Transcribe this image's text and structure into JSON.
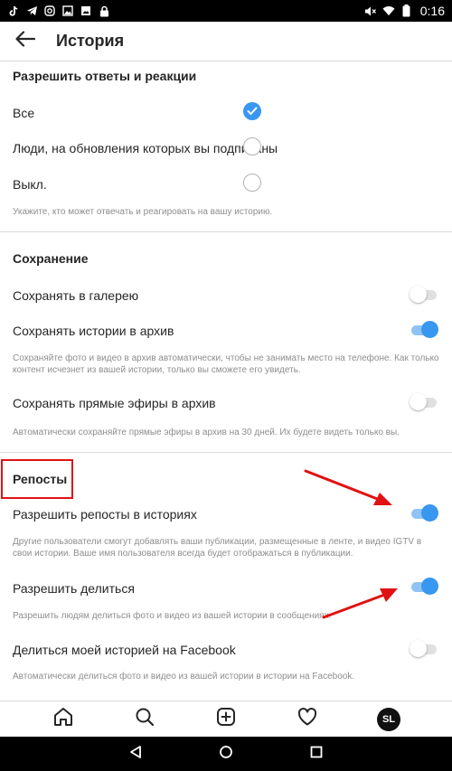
{
  "status_bar": {
    "time": "0:16",
    "icons": [
      "tiktok-icon",
      "telegram-icon",
      "instagram-icon",
      "gallery-icon",
      "image-icon",
      "lock-icon",
      "mute-icon",
      "wifi-icon",
      "battery-icon"
    ]
  },
  "header": {
    "back_icon": "arrow-left-icon",
    "title": "История"
  },
  "replies": {
    "title": "Разрешить ответы и реакции",
    "options": [
      {
        "label": "Все",
        "selected": true
      },
      {
        "label": "Люди, на обновления которых вы подписаны",
        "selected": false
      },
      {
        "label": "Выкл.",
        "selected": false
      }
    ],
    "helper": "Укажите, кто может отвечать и реагировать на вашу историю."
  },
  "saving": {
    "title": "Сохранение",
    "gallery_label": "Сохранять в галерею",
    "gallery_on": false,
    "archive_label": "Сохранять истории в архив",
    "archive_on": true,
    "archive_helper": "Сохраняйте фото и видео в архив автоматически, чтобы не занимать место на телефоне. Как только контент исчезнет из вашей истории, только вы сможете его увидеть.",
    "live_label": "Сохранять прямые эфиры в архив",
    "live_on": false,
    "live_helper": "Автоматически сохраняйте прямые эфиры в архив на 30 дней. Их будете видеть только вы."
  },
  "reposts": {
    "title": "Репосты",
    "allow_label": "Разрешить репосты в историях",
    "allow_on": true,
    "allow_helper": "Другие пользователи смогут добавлять ваши публикации, размещенные в ленте, и видео IGTV в свои истории. Ваше имя пользователя всегда будет отображаться в публикации.",
    "share_label": "Разрешить делиться",
    "share_on": true,
    "share_helper": "Разрешить людям делиться фото и видео из вашей истории в сообщениях.",
    "facebook_label": "Делиться моей историей на Facebook",
    "facebook_on": false,
    "facebook_helper": "Автоматически делиться фото и видео из вашей истории в истории на Facebook."
  },
  "bottom_nav": {
    "items": [
      "home-icon",
      "search-icon",
      "add-post-icon",
      "heart-icon",
      "profile-avatar"
    ],
    "avatar_initials": "SL"
  },
  "android_nav": [
    "back-triangle-icon",
    "home-circle-icon",
    "recents-square-icon"
  ],
  "colors": {
    "accent": "#3897f0",
    "annotation_red": "#e01212",
    "helper_text": "#8e8e8e"
  }
}
